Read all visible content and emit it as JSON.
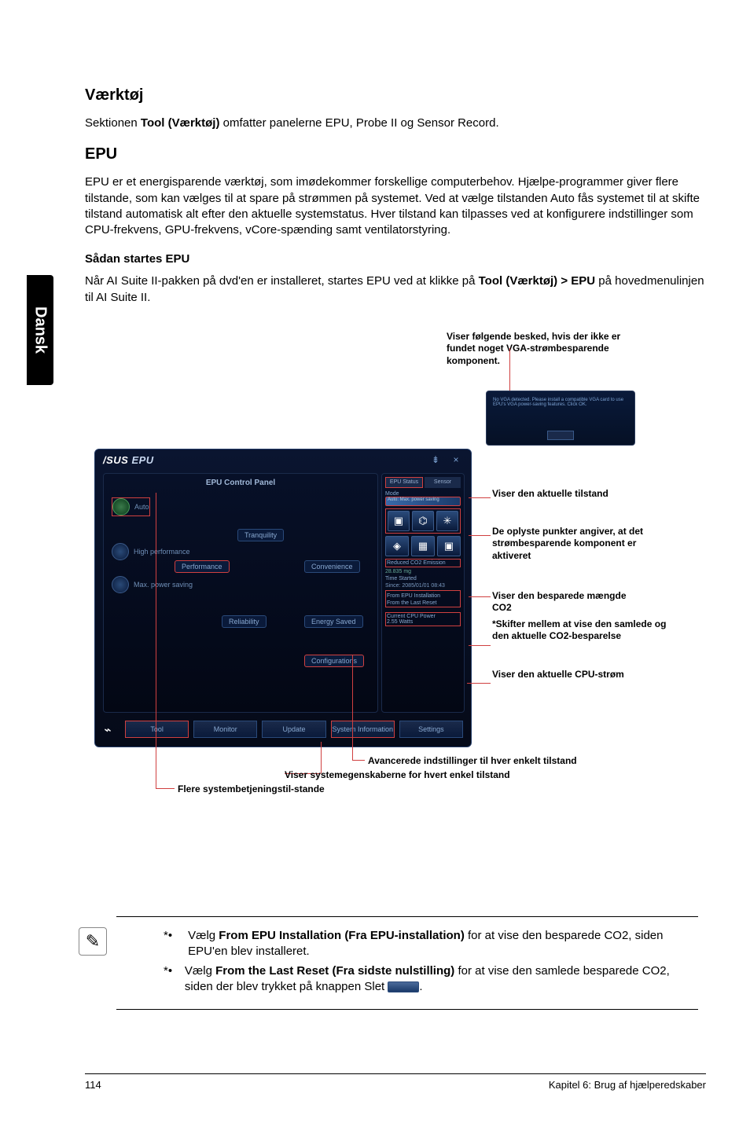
{
  "sidetab": "Dansk",
  "sec1": {
    "title": "Værktøj",
    "p_prefix": "Sektionen ",
    "p_bold": "Tool (Værktøj)",
    "p_suffix": " omfatter panelerne EPU, Probe II og Sensor Record."
  },
  "sec2": {
    "title": "EPU",
    "p": "EPU er et energisparende værktøj, som imødekommer forskellige computerbehov. Hjælpe-programmer giver flere tilstande, som kan vælges til at spare på strømmen på systemet. Ved at vælge tilstanden Auto fås systemet til at skifte tilstand automatisk alt efter den aktuelle systemstatus. Hver tilstand kan tilpasses ved at konfigurere indstillinger som CPU-frekvens, GPU-frekvens, vCore-spænding samt ventilatorstyring."
  },
  "sec3": {
    "title": "Sådan startes EPU",
    "p_prefix": "Når AI Suite II-pakken på dvd'en er installeret, startes EPU ved at klikke på ",
    "p_bold": "Tool (Værktøj) > EPU",
    "p_suffix": " på hovedmenulinjen til AI Suite II."
  },
  "fig": {
    "warn_label": "Viser følgende besked, hvis der ikke er fundet noget VGA-strømbesparende komponent.",
    "window": {
      "brand": "/SUS",
      "app": "EPU",
      "left_header": "EPU Control Panel",
      "modes": {
        "auto": "Auto",
        "high": "High performance",
        "max": "Max. power saving"
      },
      "chips": {
        "tranquility": "Tranquility",
        "performance": "Performance",
        "convenience": "Convenience",
        "reliability": "Reliability",
        "energy": "Energy Saved",
        "config": "Configurations"
      },
      "bottom": [
        "Tool",
        "Monitor",
        "Update",
        "System Information",
        "Settings"
      ],
      "right_tabs": [
        "EPU Status",
        "Sensor"
      ],
      "right": {
        "mode": "Mode",
        "mode_val": "Auto: Max. power saving",
        "icons_row2": [
          "Chipset",
          "Memory",
          "EVGA"
        ],
        "co2": "Reduced CO2 Emission",
        "co2_val": "28.835 mg",
        "time": "Time Started",
        "time_val": "Since: 2085/01/01 08:43",
        "opt1": "From EPU Installation",
        "opt2": "From the Last Reset",
        "cpu": "Current CPU Power",
        "cpu_val": "2.55 Watts"
      }
    },
    "callouts": {
      "c_mode": "Viser den aktuelle tilstand",
      "c_comp": "De oplyste punkter angiver, at det strømbesparende komponent er aktiveret",
      "c_co2a": "Viser den besparede mængde CO2",
      "c_co2b": "*Skifter mellem at vise den samlede og den aktuelle CO2-besparelse",
      "c_cpu": "Viser den aktuelle CPU-strøm",
      "c_adv": "Avancerede indstillinger til hver enkelt tilstand",
      "c_sys": "Viser systemegenskaberne for hvert enkel tilstand",
      "c_modes": "Flere systembetjeningstil-stande"
    }
  },
  "notes": {
    "n1_prefix": "Vælg ",
    "n1_bold": "From EPU Installation (Fra EPU-installation)",
    "n1_suffix": " for at vise den besparede CO2, siden EPU'en blev installeret.",
    "n2_prefix": "Vælg ",
    "n2_bold": "From the Last Reset (Fra sidste nulstilling)",
    "n2_suffix_a": " for at vise den samlede besparede CO2, siden der blev trykket på knappen Slet ",
    "n2_suffix_b": "."
  },
  "footer": {
    "page": "114",
    "chapter": "Kapitel 6: Brug af hjælperedskaber"
  }
}
